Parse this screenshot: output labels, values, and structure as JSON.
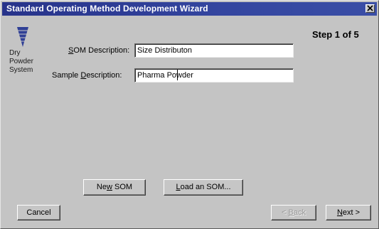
{
  "window": {
    "title": "Standard Operating Method Development Wizard",
    "close_icon": "close-icon"
  },
  "header": {
    "step": "Step 1 of 5"
  },
  "system": {
    "icon": "dry-powder-system-icon",
    "line1": "Dry",
    "line2": "Powder",
    "line3": "System"
  },
  "form": {
    "som_label_prefix": "S",
    "som_label_rest": "OM Description:",
    "som_value": "Size Distributon",
    "sample_label_prefix": "Sample ",
    "sample_label_accel": "D",
    "sample_label_rest": "escription:",
    "sample_value": "Pharma Powder"
  },
  "buttons": {
    "new_som_prefix": "Ne",
    "new_som_accel": "w",
    "new_som_rest": " SOM",
    "load_som_accel": "L",
    "load_som_rest": "oad an SOM...",
    "cancel": "Cancel",
    "back_prefix": "< ",
    "back_accel": "B",
    "back_rest": "ack",
    "next_accel": "N",
    "next_rest": "ext >"
  },
  "colors": {
    "titlebar": "#2c3a8a",
    "face": "#c6c6c6",
    "icon_blue": "#2f3f95"
  }
}
